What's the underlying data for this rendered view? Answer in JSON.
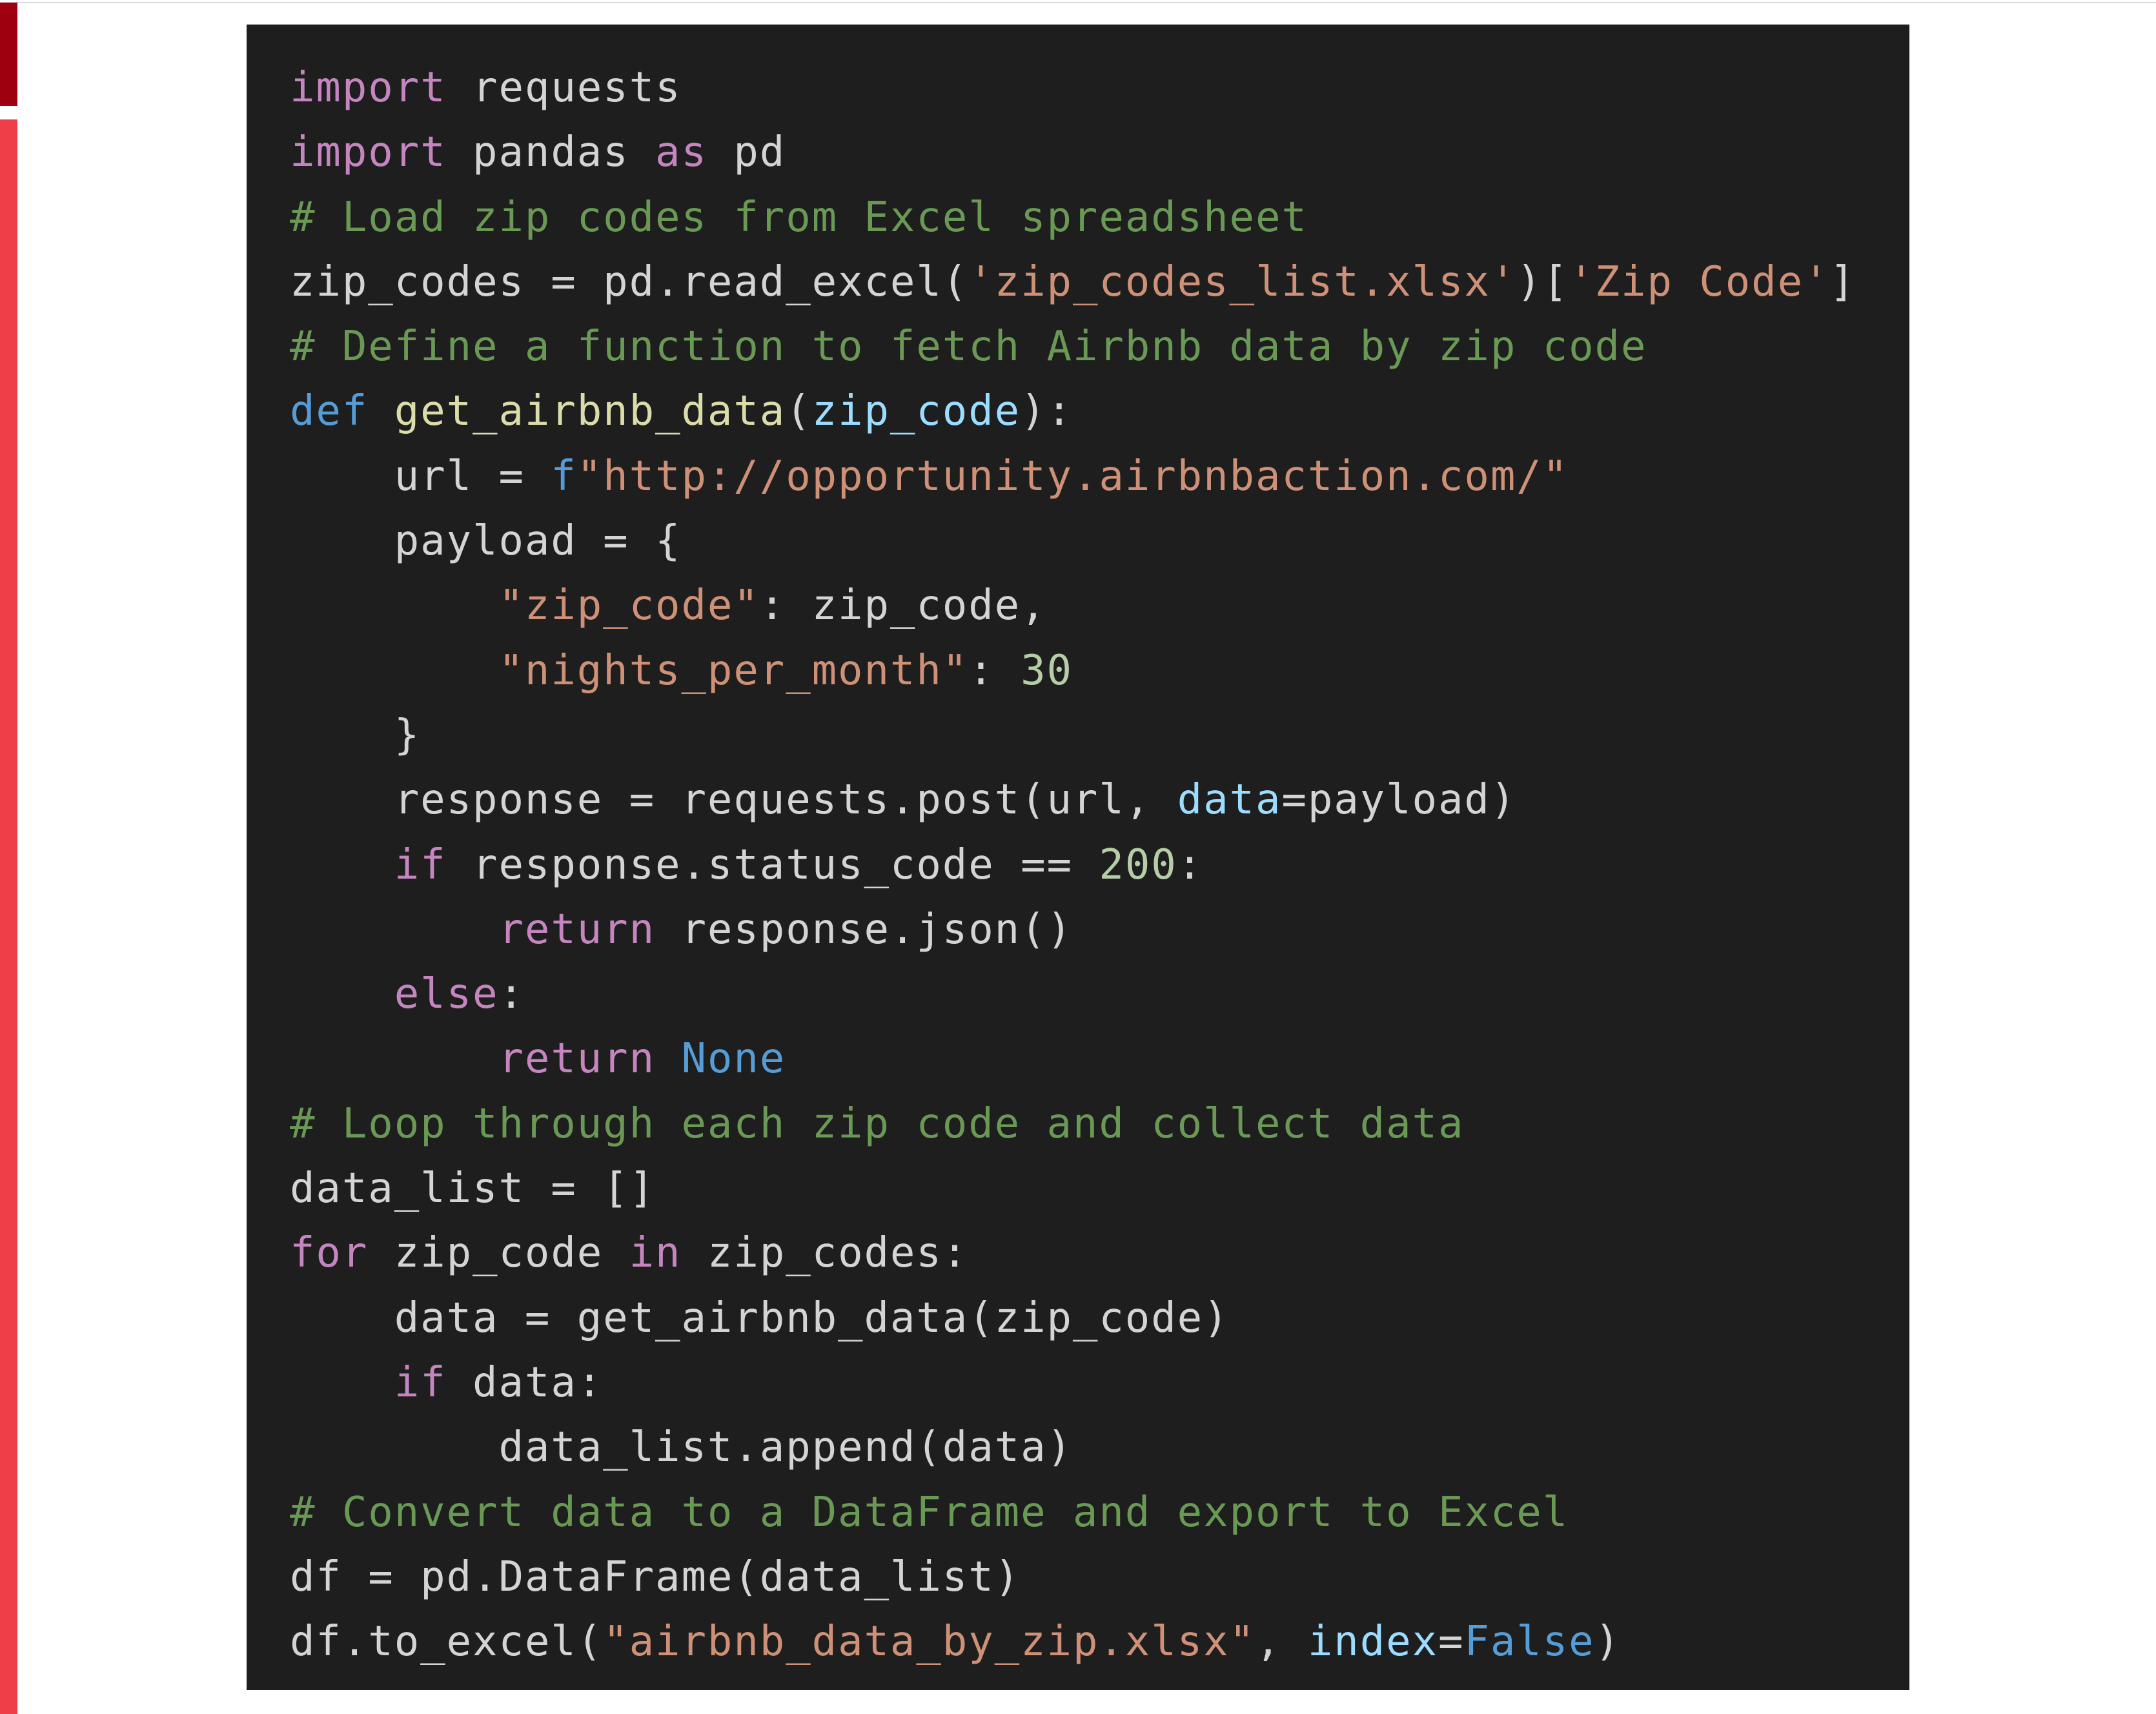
{
  "colors": {
    "background": "#1e1e1e",
    "text": "#d4d4d4",
    "keyword_control": "#c586c0",
    "keyword_decl": "#569cd6",
    "function": "#dcdcaa",
    "parameter": "#9cdcfe",
    "string": "#ce9178",
    "number": "#b5cea8",
    "comment": "#6a9955",
    "accent_dark_red": "#9e0010",
    "accent_red": "#ef3e47"
  },
  "code": {
    "language": "python",
    "lines": [
      [
        {
          "t": "kw",
          "v": "import"
        },
        {
          "t": "text",
          "v": " requests"
        }
      ],
      [
        {
          "t": "kw",
          "v": "import"
        },
        {
          "t": "text",
          "v": " pandas "
        },
        {
          "t": "kw",
          "v": "as"
        },
        {
          "t": "text",
          "v": " pd"
        }
      ],
      [
        {
          "t": "comment",
          "v": "# Load zip codes from Excel spreadsheet"
        }
      ],
      [
        {
          "t": "text",
          "v": "zip_codes = pd.read_excel("
        },
        {
          "t": "str",
          "v": "'zip_codes_list.xlsx'"
        },
        {
          "t": "text",
          "v": ")["
        },
        {
          "t": "str",
          "v": "'Zip Code'"
        },
        {
          "t": "text",
          "v": "]"
        }
      ],
      [
        {
          "t": "comment",
          "v": "# Define a function to fetch Airbnb data by zip code"
        }
      ],
      [
        {
          "t": "decl",
          "v": "def"
        },
        {
          "t": "text",
          "v": " "
        },
        {
          "t": "fn",
          "v": "get_airbnb_data"
        },
        {
          "t": "text",
          "v": "("
        },
        {
          "t": "param",
          "v": "zip_code"
        },
        {
          "t": "text",
          "v": "):"
        }
      ],
      [
        {
          "t": "text",
          "v": "    url = "
        },
        {
          "t": "decl",
          "v": "f"
        },
        {
          "t": "str",
          "v": "\"http://opportunity.airbnbaction.com/\""
        }
      ],
      [
        {
          "t": "text",
          "v": "    payload = {"
        }
      ],
      [
        {
          "t": "text",
          "v": "        "
        },
        {
          "t": "str",
          "v": "\"zip_code\""
        },
        {
          "t": "text",
          "v": ": zip_code,"
        }
      ],
      [
        {
          "t": "text",
          "v": "        "
        },
        {
          "t": "str",
          "v": "\"nights_per_month\""
        },
        {
          "t": "text",
          "v": ": "
        },
        {
          "t": "num",
          "v": "30"
        }
      ],
      [
        {
          "t": "text",
          "v": "    }"
        }
      ],
      [
        {
          "t": "text",
          "v": "    response = requests.post(url, "
        },
        {
          "t": "param",
          "v": "data"
        },
        {
          "t": "text",
          "v": "=payload)"
        }
      ],
      [
        {
          "t": "text",
          "v": "    "
        },
        {
          "t": "kw",
          "v": "if"
        },
        {
          "t": "text",
          "v": " response.status_code == "
        },
        {
          "t": "num",
          "v": "200"
        },
        {
          "t": "text",
          "v": ":"
        }
      ],
      [
        {
          "t": "text",
          "v": "        "
        },
        {
          "t": "kw",
          "v": "return"
        },
        {
          "t": "text",
          "v": " response.json()"
        }
      ],
      [
        {
          "t": "text",
          "v": "    "
        },
        {
          "t": "kw",
          "v": "else"
        },
        {
          "t": "text",
          "v": ":"
        }
      ],
      [
        {
          "t": "text",
          "v": "        "
        },
        {
          "t": "kw",
          "v": "return"
        },
        {
          "t": "text",
          "v": " "
        },
        {
          "t": "const",
          "v": "None"
        }
      ],
      [
        {
          "t": "comment",
          "v": "# Loop through each zip code and collect data"
        }
      ],
      [
        {
          "t": "text",
          "v": "data_list = []"
        }
      ],
      [
        {
          "t": "kw",
          "v": "for"
        },
        {
          "t": "text",
          "v": " zip_code "
        },
        {
          "t": "kw",
          "v": "in"
        },
        {
          "t": "text",
          "v": " zip_codes:"
        }
      ],
      [
        {
          "t": "text",
          "v": "    data = get_airbnb_data(zip_code)"
        }
      ],
      [
        {
          "t": "text",
          "v": "    "
        },
        {
          "t": "kw",
          "v": "if"
        },
        {
          "t": "text",
          "v": " data:"
        }
      ],
      [
        {
          "t": "text",
          "v": "        data_list.append(data)"
        }
      ],
      [
        {
          "t": "comment",
          "v": "# Convert data to a DataFrame and export to Excel"
        }
      ],
      [
        {
          "t": "text",
          "v": "df = pd.DataFrame(data_list)"
        }
      ],
      [
        {
          "t": "text",
          "v": "df.to_excel("
        },
        {
          "t": "str",
          "v": "\"airbnb_data_by_zip.xlsx\""
        },
        {
          "t": "text",
          "v": ", "
        },
        {
          "t": "param",
          "v": "index"
        },
        {
          "t": "text",
          "v": "="
        },
        {
          "t": "const",
          "v": "False"
        },
        {
          "t": "text",
          "v": ")"
        }
      ]
    ]
  }
}
